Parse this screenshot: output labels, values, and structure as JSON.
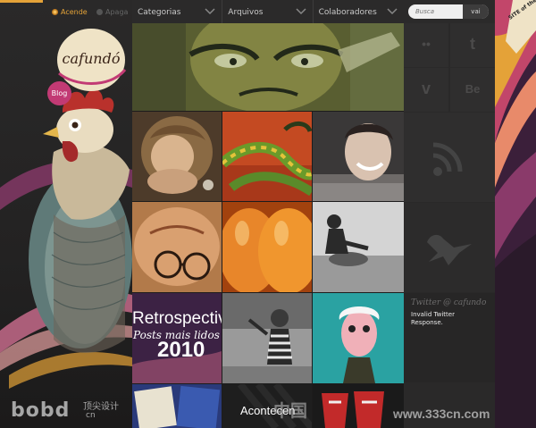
{
  "header": {
    "switch_on_label": "Acende",
    "switch_off_label": "Apaga",
    "logo_text": "cafundó",
    "blog_badge": "Blog"
  },
  "nav": {
    "tabs": [
      {
        "label": "Categorias"
      },
      {
        "label": "Arquivos"
      },
      {
        "label": "Colaboradores"
      }
    ]
  },
  "search": {
    "placeholder": "Busca",
    "button_label": "vai"
  },
  "social": {
    "flickr_icon": "••",
    "twitter_icon": "t",
    "vimeo_icon": "v",
    "behance_icon": "Be"
  },
  "posts": {
    "retrospective_title": "Retrospectiv",
    "retrospective_subtitle": "Posts mais lidos e",
    "retrospective_year": "2010",
    "bottom_post_text": "Acontecen"
  },
  "twitter": {
    "title": "Twitter @ cafundo",
    "message": "Invalid Twitter Response."
  },
  "badge": {
    "site_of_month": "SITE of the MONTH"
  },
  "watermarks": {
    "bobd": "bobd",
    "bobd_cn": "顶尖设计",
    "bobd_url": "cn",
    "cn_site": "中国",
    "site": "www.333cn.com"
  },
  "colors": {
    "accent": "#e4a238",
    "blog_badge": "#c23a74",
    "background": "#1d1c1c"
  }
}
